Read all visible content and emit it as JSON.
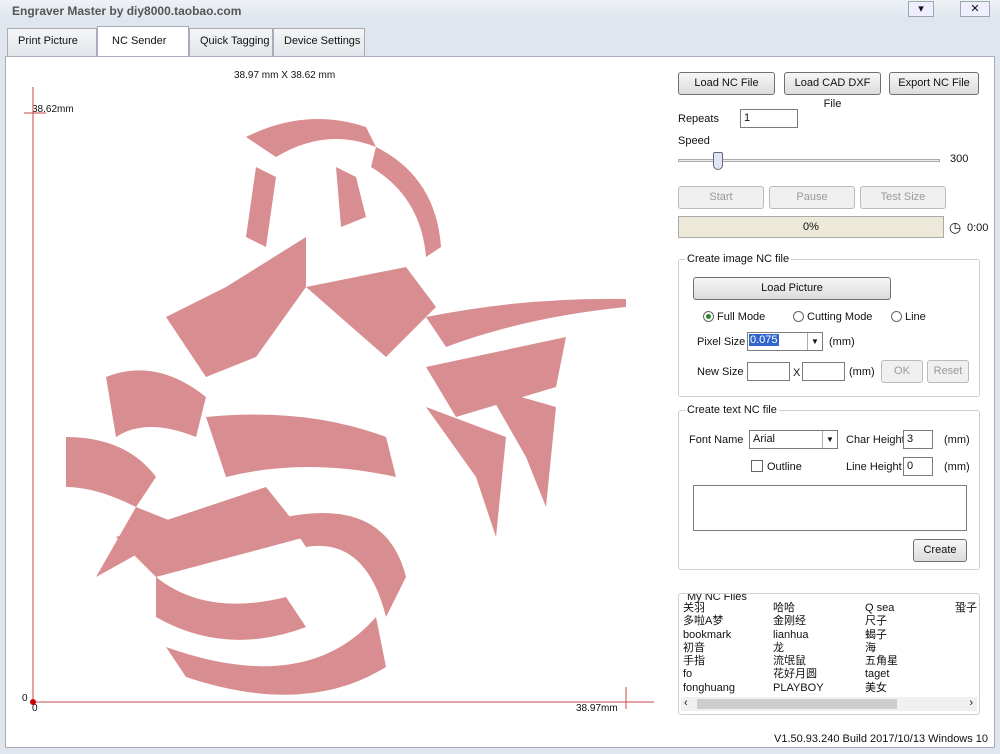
{
  "window": {
    "title": "Engraver Master by diy8000.taobao.com",
    "menu_icon": "dropdown-icon",
    "close_icon": "close-icon"
  },
  "tabs": [
    {
      "label": "Print Picture"
    },
    {
      "label": "NC Sender",
      "active": true
    },
    {
      "label": "Quick Tagging"
    },
    {
      "label": "Device Settings"
    }
  ],
  "canvas": {
    "size_label": "38.97 mm X 38.62 mm",
    "y_max": "38.62mm",
    "x_max": "38.97mm",
    "y_origin": "0",
    "x_origin": "0",
    "image_color": "#c8404a"
  },
  "buttons": {
    "load_nc": "Load NC File",
    "load_dxf": "Load CAD DXF File",
    "export_nc": "Export NC File",
    "start": "Start",
    "pause": "Pause",
    "test_size": "Test Size"
  },
  "repeats": {
    "label": "Repeats",
    "value": "1"
  },
  "speed": {
    "label": "Speed",
    "value": "300",
    "slider_percent": 15
  },
  "progress": {
    "text": "0%",
    "value": 0,
    "time": "0:00",
    "clock_icon": "clock-icon"
  },
  "image_nc": {
    "title": "Create image NC file",
    "load_picture": "Load Picture",
    "modes": [
      {
        "label": "Full Mode",
        "selected": true
      },
      {
        "label": "Cutting Mode",
        "selected": false
      },
      {
        "label": "Line",
        "selected": false
      }
    ],
    "pixel_size_label": "Pixel Size",
    "pixel_size": "0.075",
    "unit": "(mm)",
    "new_size_label": "New Size",
    "x": "X",
    "width": "",
    "height": "",
    "ok": "OK",
    "reset": "Reset"
  },
  "text_nc": {
    "title": "Create text NC file",
    "font_label": "Font Name",
    "font": "Arial",
    "char_height_label": "Char Height",
    "char_height": "3",
    "line_height_label": "Line Height",
    "line_height": "0",
    "unit": "(mm)",
    "outline": "Outline",
    "text": "",
    "create": "Create"
  },
  "nc_files": {
    "title": "My NC Files",
    "columns": [
      [
        "关羽",
        "多啦A梦",
        "bookmark",
        "初音",
        "手指",
        "fo",
        "fonghuang"
      ],
      [
        "哈哈",
        "金刚经",
        "lianhua",
        "龙",
        "流氓鼠",
        "花好月圆",
        "PLAYBOY"
      ],
      [
        "Q sea",
        "尺子",
        "蝎子",
        "海",
        "五角星",
        "taget",
        "美女"
      ],
      [
        "蛩子"
      ]
    ]
  },
  "version": "V1.50.93.240 Build 2017/10/13 Windows 10"
}
